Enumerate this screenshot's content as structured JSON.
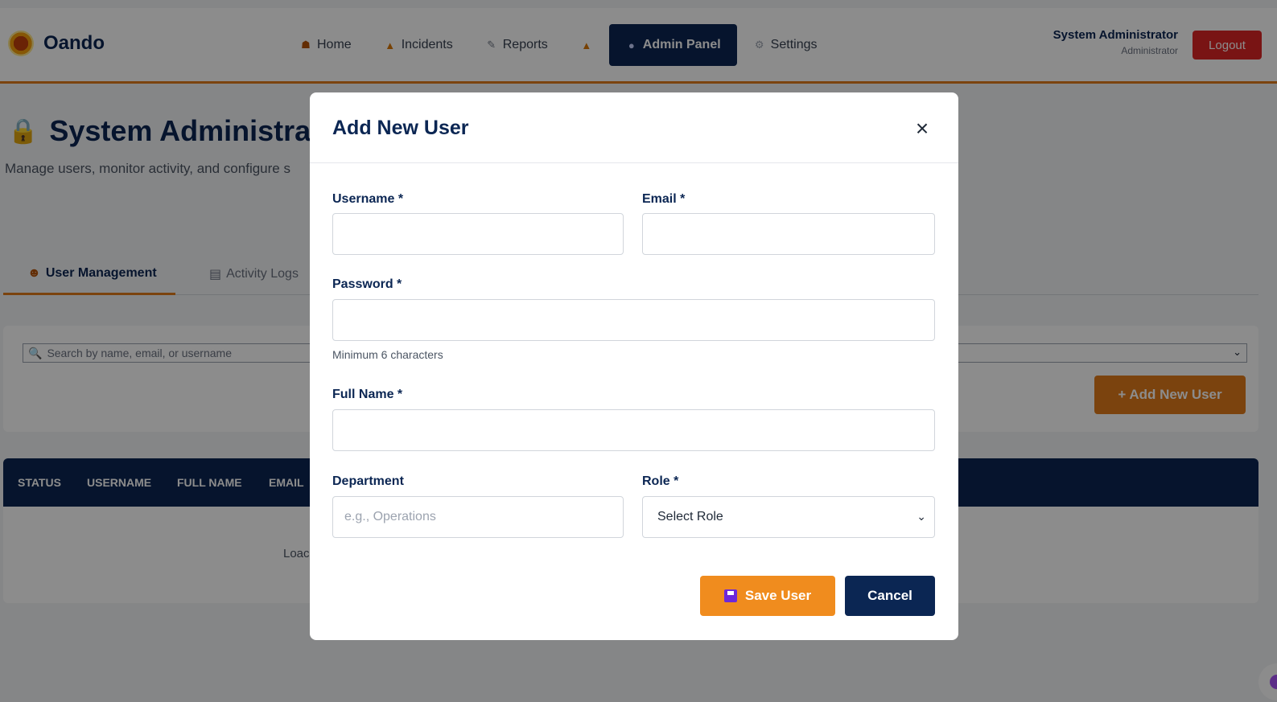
{
  "app": {
    "brand_name": "Oando"
  },
  "nav": {
    "items": [
      {
        "label": "Home",
        "icon": "home-icon"
      },
      {
        "label": "Incidents",
        "icon": "warning-icon"
      },
      {
        "label": "Reports",
        "icon": "report-icon"
      },
      {
        "label": "",
        "icon": "bell-icon"
      },
      {
        "label": "Admin Panel",
        "icon": "user-icon",
        "active": true
      },
      {
        "label": "Settings",
        "icon": "gear-icon"
      }
    ]
  },
  "user": {
    "name": "System Administrator",
    "role": "Administrator",
    "logout_label": "Logout"
  },
  "page": {
    "title": "System Administra",
    "subtitle": "Manage users, monitor activity, and configure s",
    "tabs": [
      {
        "label": "User Management",
        "icon": "users-icon",
        "active": true
      },
      {
        "label": "Activity Logs",
        "icon": "clipboard-icon",
        "active": false
      }
    ],
    "search_placeholder": "Search by name, email, or username",
    "add_user_label": "+ Add New User",
    "table_headers": [
      "STATUS",
      "USERNAME",
      "FULL NAME",
      "EMAIL"
    ],
    "loading_text": "Loac"
  },
  "modal": {
    "title": "Add New User",
    "close_symbol": "×",
    "fields": {
      "username_label": "Username *",
      "username_value": "",
      "email_label": "Email *",
      "email_value": "",
      "password_label": "Password *",
      "password_value": "",
      "password_hint": "Minimum 6 characters",
      "fullname_label": "Full Name *",
      "fullname_value": "",
      "department_label": "Department",
      "department_placeholder": "e.g., Operations",
      "role_label": "Role *",
      "role_selected": "Select Role"
    },
    "save_label": "Save User",
    "cancel_label": "Cancel"
  },
  "colors": {
    "navy": "#0b2653",
    "accent_orange": "#e07b1a",
    "logout_red": "#dc2626"
  }
}
